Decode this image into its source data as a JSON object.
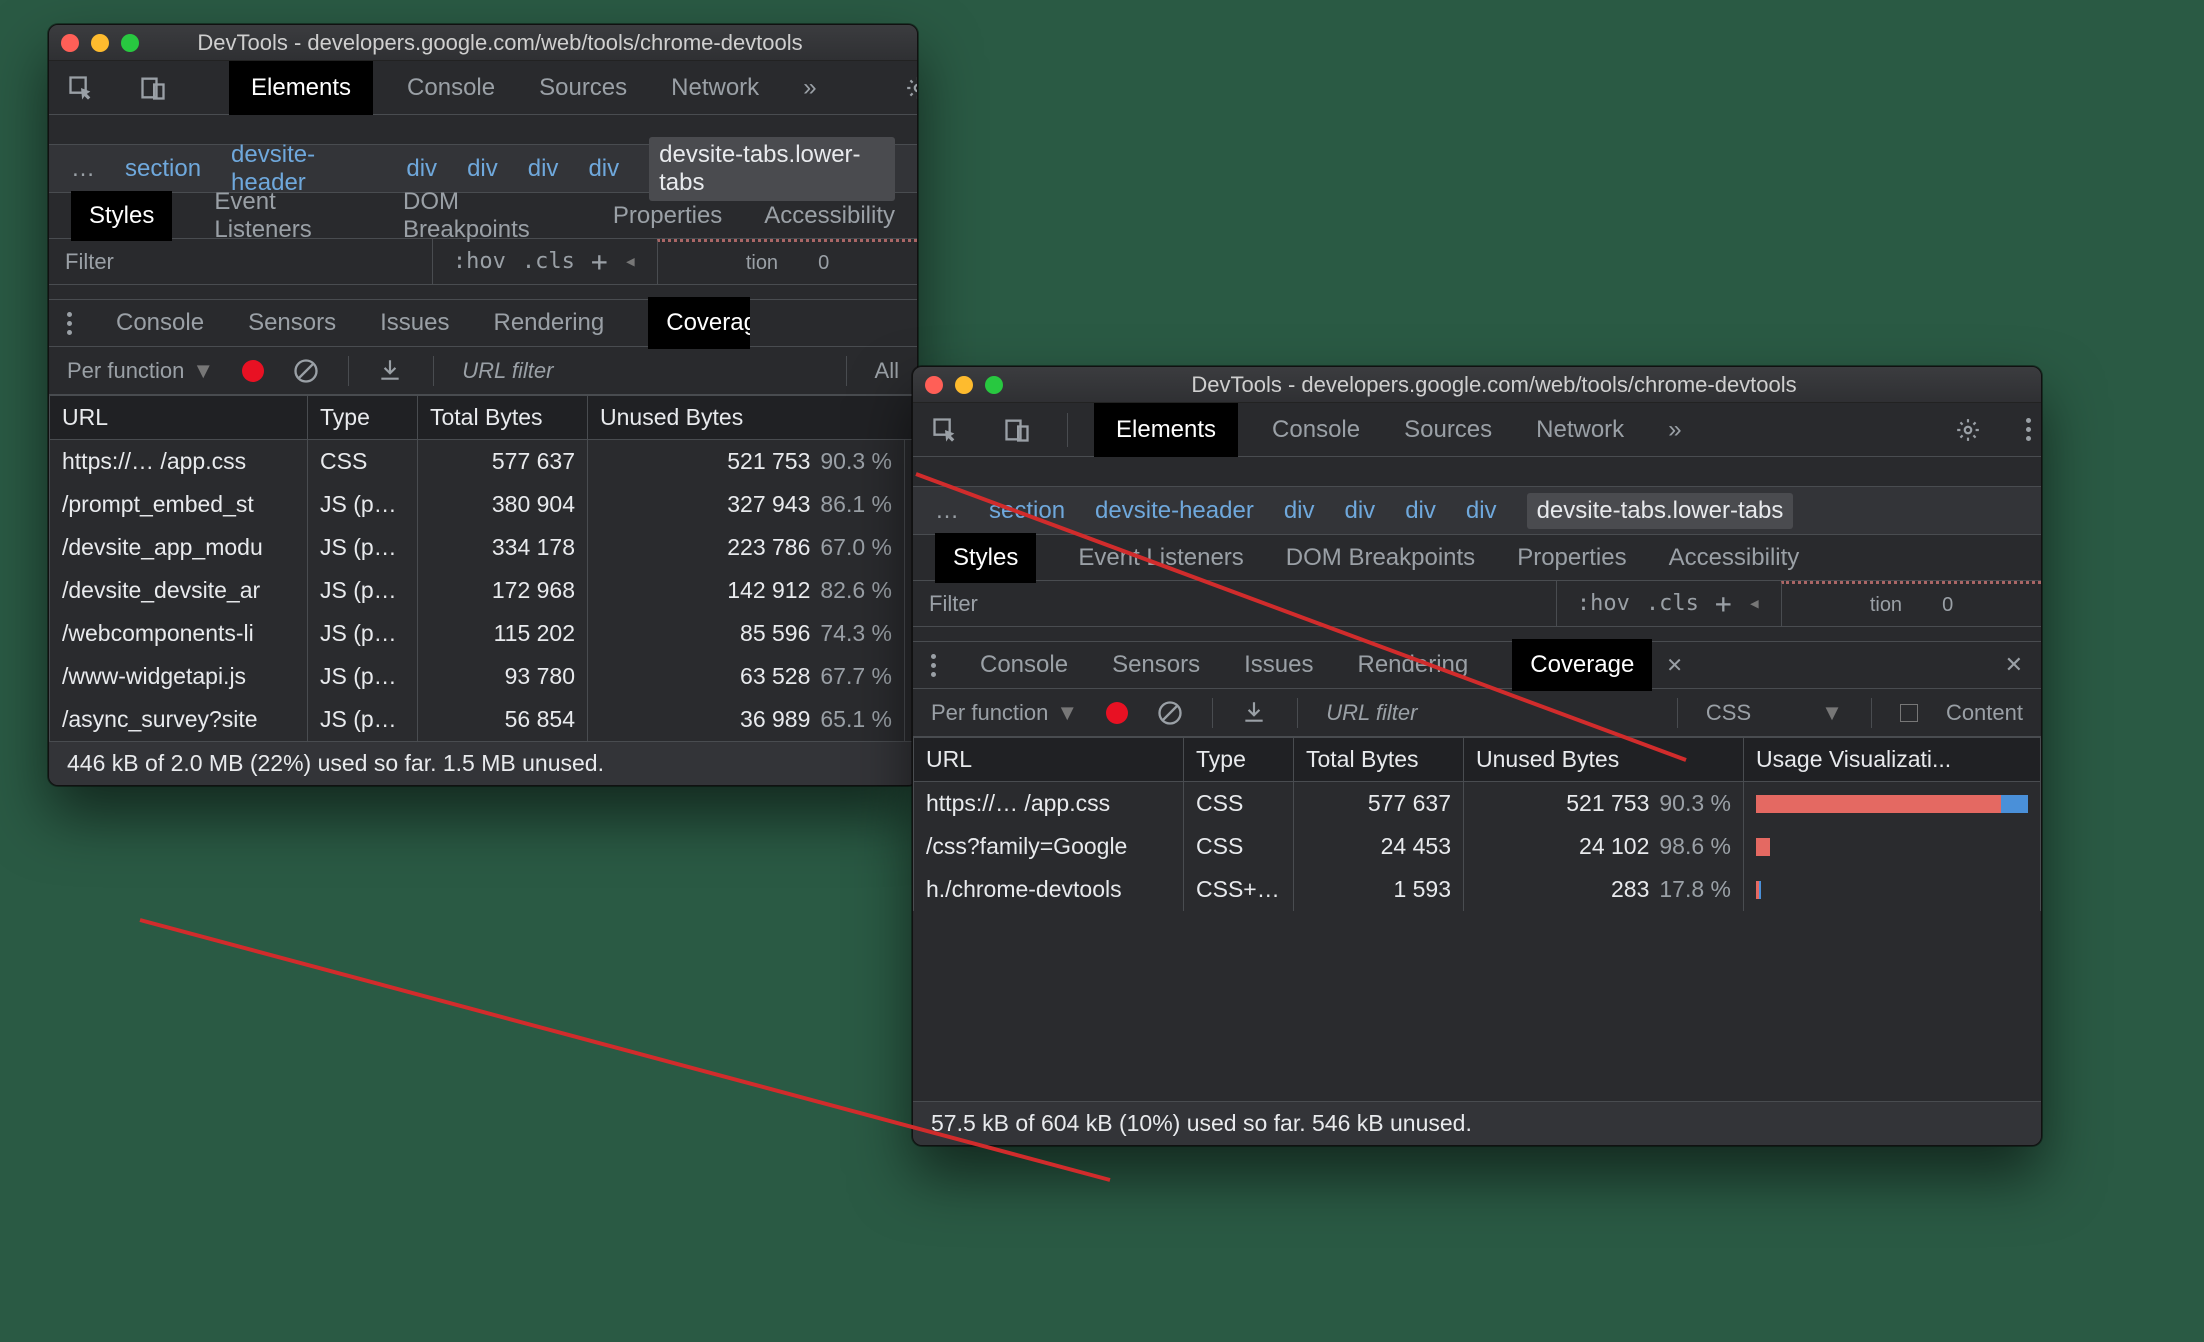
{
  "title": "DevTools - developers.google.com/web/tools/chrome-devtools",
  "main_tabs": [
    "Elements",
    "Console",
    "Sources",
    "Network"
  ],
  "main_tabs_active": "Elements",
  "breadcrumb": {
    "ellipsis": "…",
    "items": [
      "section",
      "devsite-header",
      "div",
      "div",
      "div",
      "div"
    ],
    "selected": "devsite-tabs.lower-tabs"
  },
  "panel_tabs": [
    "Styles",
    "Event Listeners",
    "DOM Breakpoints",
    "Properties",
    "Accessibility"
  ],
  "panel_tabs_active": "Styles",
  "filter": {
    "placeholder": "Filter",
    "hov": ":hov",
    "cls": ".cls",
    "side_label": "tion",
    "side_value": "0"
  },
  "drawer": {
    "tabs": [
      "Console",
      "Sensors",
      "Issues",
      "Rendering",
      "Coverage"
    ],
    "active": "Coverage"
  },
  "coverage_toolbar": {
    "per_function": "Per function",
    "url_filter": "URL filter",
    "filter_all": "All",
    "filter_css": "CSS",
    "content": "Content"
  },
  "table_headers": {
    "url": "URL",
    "type": "Type",
    "total": "Total Bytes",
    "unused": "Unused Bytes",
    "usage": "Usage Visualizati..."
  },
  "window1": {
    "rows": [
      {
        "url": "https://…  /app.css",
        "type": "CSS",
        "total": "577 637",
        "unused": "521 753",
        "pct": "90.3 %"
      },
      {
        "url": "/prompt_embed_st",
        "type": "JS (p…",
        "total": "380 904",
        "unused": "327 943",
        "pct": "86.1 %"
      },
      {
        "url": "/devsite_app_modu",
        "type": "JS (p…",
        "total": "334 178",
        "unused": "223 786",
        "pct": "67.0 %"
      },
      {
        "url": "/devsite_devsite_ar",
        "type": "JS (p…",
        "total": "172 968",
        "unused": "142 912",
        "pct": "82.6 %"
      },
      {
        "url": "/webcomponents-li",
        "type": "JS (p…",
        "total": "115 202",
        "unused": "85 596",
        "pct": "74.3 %"
      },
      {
        "url": "/www-widgetapi.js",
        "type": "JS (p…",
        "total": "93 780",
        "unused": "63 528",
        "pct": "67.7 %"
      },
      {
        "url": "/async_survey?site",
        "type": "JS (p…",
        "total": "56 854",
        "unused": "36 989",
        "pct": "65.1 %"
      }
    ],
    "status": "446 kB of 2.0 MB (22%) used so far. 1.5 MB unused."
  },
  "window2": {
    "rows": [
      {
        "url": "https://…  /app.css",
        "type": "CSS",
        "total": "577 637",
        "unused": "521 753",
        "pct": "90.3 %",
        "red": 90,
        "blue": 10
      },
      {
        "url": "/css?family=Google",
        "type": "CSS",
        "total": "24 453",
        "unused": "24 102",
        "pct": "98.6 %",
        "red": 5,
        "blue": 0
      },
      {
        "url": "h./chrome-devtools",
        "type": "CSS+…",
        "total": "1 593",
        "unused": "283",
        "pct": "17.8 %",
        "red": 1,
        "blue": 1
      }
    ],
    "status": "57.5 kB of 604 kB (10%) used so far. 546 kB unused."
  }
}
